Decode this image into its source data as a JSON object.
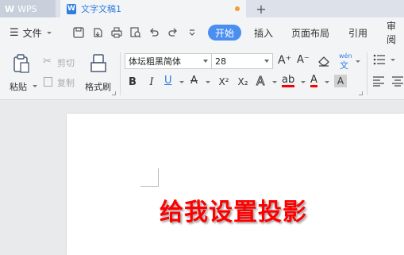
{
  "titlebar": {
    "app_label": "WPS",
    "doc_title": "文字文稿1",
    "doc_icon_letter": "W",
    "new_tab": "+"
  },
  "menubar": {
    "file": "文件",
    "home_pill": "开始",
    "tabs": [
      "插入",
      "页面布局",
      "引用",
      "审阅"
    ]
  },
  "ribbon": {
    "paste": "粘贴",
    "cut": "剪切",
    "copy": "复制",
    "format_painter": "格式刷",
    "font_name": "体坛粗黑简体",
    "font_size": "28",
    "bold": "B",
    "italic": "I",
    "underline": "U",
    "strike": "A",
    "superscript": "X²",
    "subscript": "X₂",
    "grow": "A⁺",
    "shrink": "A⁻",
    "pinyin": "wén"
  },
  "document": {
    "body_text": "给我设置投影"
  },
  "colors": {
    "accent": "#4a8ef0",
    "doc_blue": "#2f7de1",
    "text_red": "#ff0000",
    "unsaved_dot": "#f39c3a"
  }
}
